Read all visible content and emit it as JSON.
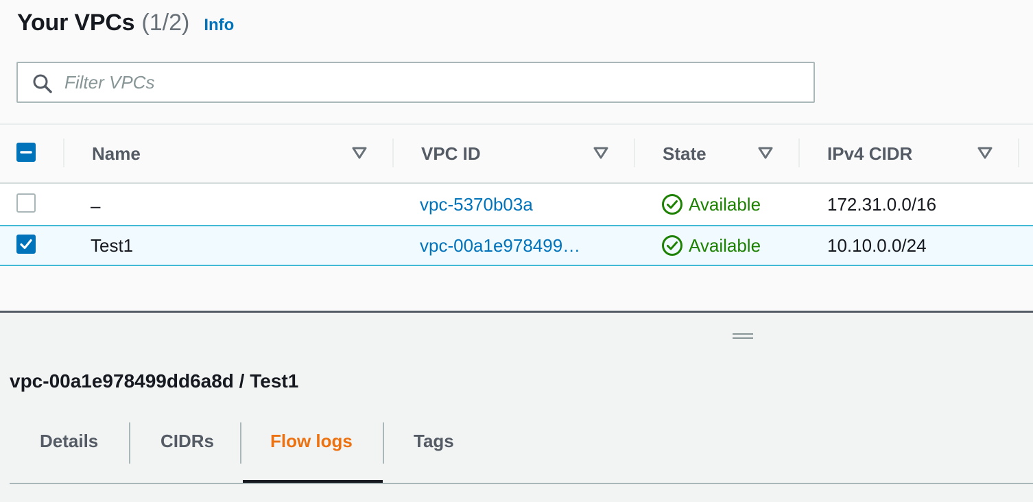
{
  "header": {
    "title": "Your VPCs",
    "count": "(1/2)",
    "info_label": "Info"
  },
  "filter": {
    "placeholder": "Filter VPCs",
    "value": ""
  },
  "table": {
    "select_all_state": "indeterminate",
    "columns": [
      "Name",
      "VPC ID",
      "State",
      "IPv4 CIDR"
    ],
    "rows": [
      {
        "selected": false,
        "name": "–",
        "vpc_id": "vpc-5370b03a",
        "state": "Available",
        "cidr": "172.31.0.0/16"
      },
      {
        "selected": true,
        "name": "Test1",
        "vpc_id": "vpc-00a1e978499…",
        "state": "Available",
        "cidr": "10.10.0.0/24"
      }
    ]
  },
  "details": {
    "title": "vpc-00a1e978499dd6a8d / Test1",
    "tabs": [
      {
        "label": "Details",
        "active": false
      },
      {
        "label": "CIDRs",
        "active": false
      },
      {
        "label": "Flow logs",
        "active": true
      },
      {
        "label": "Tags",
        "active": false
      }
    ]
  },
  "colors": {
    "link": "#0073bb",
    "available": "#1d8102",
    "active_tab": "#ec7211",
    "checkbox": "#0073bb",
    "selected_row_bg": "#f1faff",
    "selected_row_border": "#44b9d6"
  },
  "icons": {
    "search": "search-icon",
    "sort": "caret-down-icon",
    "status": "check-circle-icon"
  }
}
